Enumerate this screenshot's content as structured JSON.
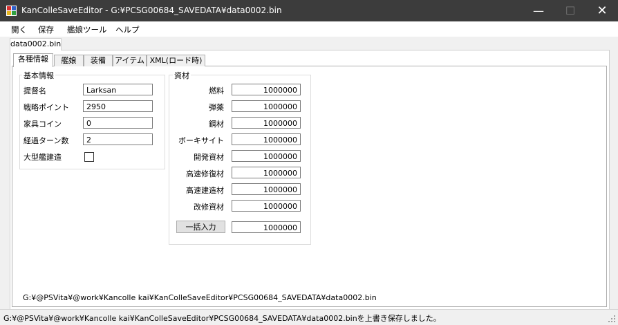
{
  "window": {
    "title": "KanColleSaveEditor - G:¥PCSG00684_SAVEDATA¥data0002.bin",
    "minimize": "—",
    "maximize": "☐",
    "close": "✕"
  },
  "menu": {
    "open": "開く",
    "save": "保存",
    "shipgirl_tools": "艦娘ツール",
    "help": "ヘルプ"
  },
  "file_tab": "data0002.bin",
  "tabs": [
    "各種情報",
    "艦娘",
    "装備",
    "アイテム",
    "XML(ロード時)"
  ],
  "basic_info": {
    "title": "基本情報",
    "admiral_name_label": "提督名",
    "admiral_name": "Larksan",
    "strategy_points_label": "戦略ポイント",
    "strategy_points": "2950",
    "furniture_coins_label": "家具コイン",
    "furniture_coins": "0",
    "elapsed_turns_label": "経過ターン数",
    "elapsed_turns": "2",
    "large_build_label": "大型艦建造",
    "large_build_checked": false
  },
  "resources": {
    "title": "資材",
    "items": [
      {
        "label": "燃料",
        "value": "1000000"
      },
      {
        "label": "弾薬",
        "value": "1000000"
      },
      {
        "label": "鋼材",
        "value": "1000000"
      },
      {
        "label": "ボーキサイト",
        "value": "1000000"
      },
      {
        "label": "開発資材",
        "value": "1000000"
      },
      {
        "label": "高速修復材",
        "value": "1000000"
      },
      {
        "label": "高速建造材",
        "value": "1000000"
      },
      {
        "label": "改修資材",
        "value": "1000000"
      }
    ],
    "bulk_button": "一括入力",
    "bulk_value": "1000000"
  },
  "path": "G:¥@PSVita¥@work¥Kancolle kai¥KanColleSaveEditor¥PCSG00684_SAVEDATA¥data0002.bin",
  "status": "G:¥@PSVita¥@work¥Kancolle kai¥KanColleSaveEditor¥PCSG00684_SAVEDATA¥data0002.binを上書き保存しました。",
  "icons": {
    "app": "app-icon",
    "grip": "resize-grip-icon"
  }
}
